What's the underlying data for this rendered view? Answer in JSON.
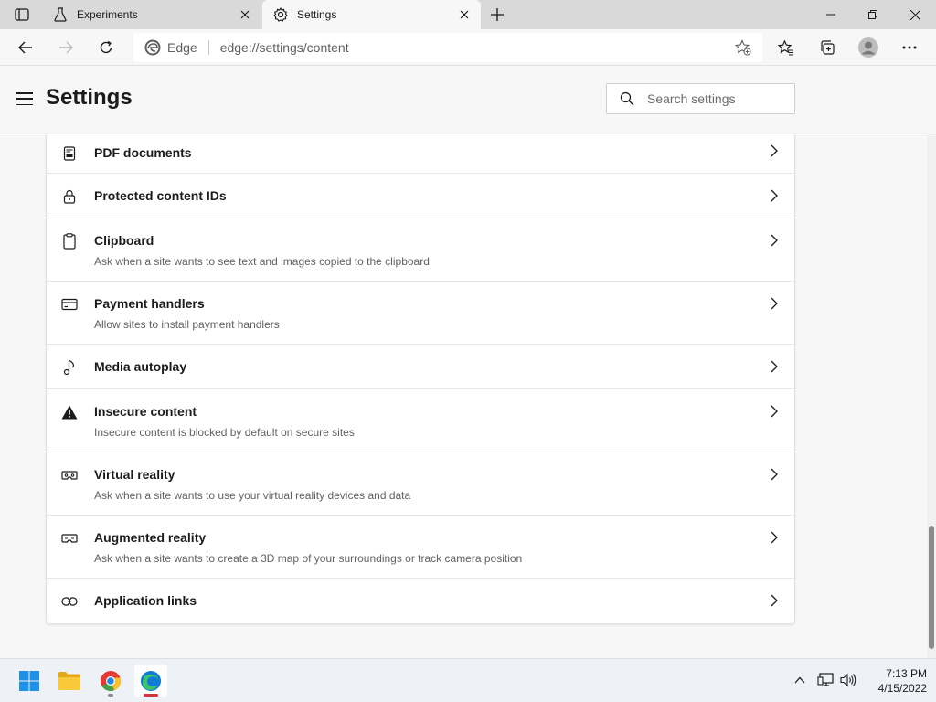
{
  "tabs": [
    {
      "title": "Experiments",
      "icon": "flask-icon",
      "active": false
    },
    {
      "title": "Settings",
      "icon": "gear-icon",
      "active": true
    }
  ],
  "address_bar": {
    "scheme_label": "Edge",
    "url": "edge://settings/content"
  },
  "header": {
    "title": "Settings",
    "search_placeholder": "Search settings"
  },
  "settings_items": [
    {
      "icon": "pdf-document-icon",
      "title": "PDF documents",
      "description": ""
    },
    {
      "icon": "lock-icon",
      "title": "Protected content IDs",
      "description": ""
    },
    {
      "icon": "clipboard-icon",
      "title": "Clipboard",
      "description": "Ask when a site wants to see text and images copied to the clipboard"
    },
    {
      "icon": "credit-card-icon",
      "title": "Payment handlers",
      "description": "Allow sites to install payment handlers"
    },
    {
      "icon": "music-note-icon",
      "title": "Media autoplay",
      "description": ""
    },
    {
      "icon": "warning-icon",
      "title": "Insecure content",
      "description": "Insecure content is blocked by default on secure sites"
    },
    {
      "icon": "vr-headset-icon",
      "title": "Virtual reality",
      "description": "Ask when a site wants to use your virtual reality devices and data"
    },
    {
      "icon": "ar-headset-icon",
      "title": "Augmented reality",
      "description": "Ask when a site wants to create a 3D map of your surroundings or track camera position"
    },
    {
      "icon": "link-icon",
      "title": "Application links",
      "description": ""
    }
  ],
  "taskbar": {
    "apps": [
      "windows-start-icon",
      "file-explorer-icon",
      "chrome-icon",
      "edge-icon"
    ],
    "time": "7:13 PM",
    "date": "4/15/2022"
  },
  "colors": {
    "tabstrip": "#d9d9d9",
    "accent_edge": "#0f7bd6",
    "warning": "#1b1b1b"
  }
}
